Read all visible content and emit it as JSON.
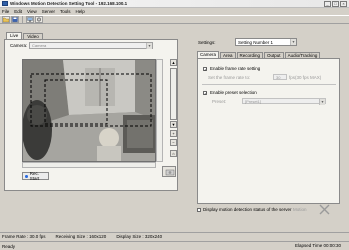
{
  "window": {
    "title": "Windows Motion Detection Setting Tool - 192.168.100.1",
    "buttons": [
      "_",
      "□",
      "×"
    ]
  },
  "menubar": {
    "items": [
      "File",
      "Edit",
      "View",
      "Server",
      "Tools",
      "Help"
    ]
  },
  "toolbar": {
    "icons": [
      "open-icon",
      "save-icon",
      "connect-icon",
      "settings-icon"
    ]
  },
  "left": {
    "tabs": [
      "Live",
      "Video"
    ],
    "camera_label": "Camera:",
    "camera_value": "Camera",
    "rec_button": "Rec. Start"
  },
  "right": {
    "settings_label": "Settings:",
    "settings_value": "Setting Number 1",
    "tabs": [
      "Camera",
      "Area",
      "Recording",
      "Output",
      "Audio/Tracking"
    ],
    "frame_rate_setting_label": "Enable frame rate setting",
    "frame_rate_field_label": "Set the frame rate to:",
    "frame_rate_value": "30",
    "frame_rate_unit": "fps(30 fps MAX)",
    "preset_label": "Enable preset selection",
    "preset_field_label": "Preset:",
    "preset_value": "[Preset1]",
    "display_status_label": "Display motion detection status of the server",
    "motion_button": "Motion"
  },
  "info": {
    "frame_rate": "Frame Rate : 30.0 fps",
    "receiving_size": "Receiving Size : 160x120",
    "display_size": "Display Size : 320x240"
  },
  "status": {
    "state": "Ready",
    "elapsed": "Elapsed Time 00:00:30"
  }
}
